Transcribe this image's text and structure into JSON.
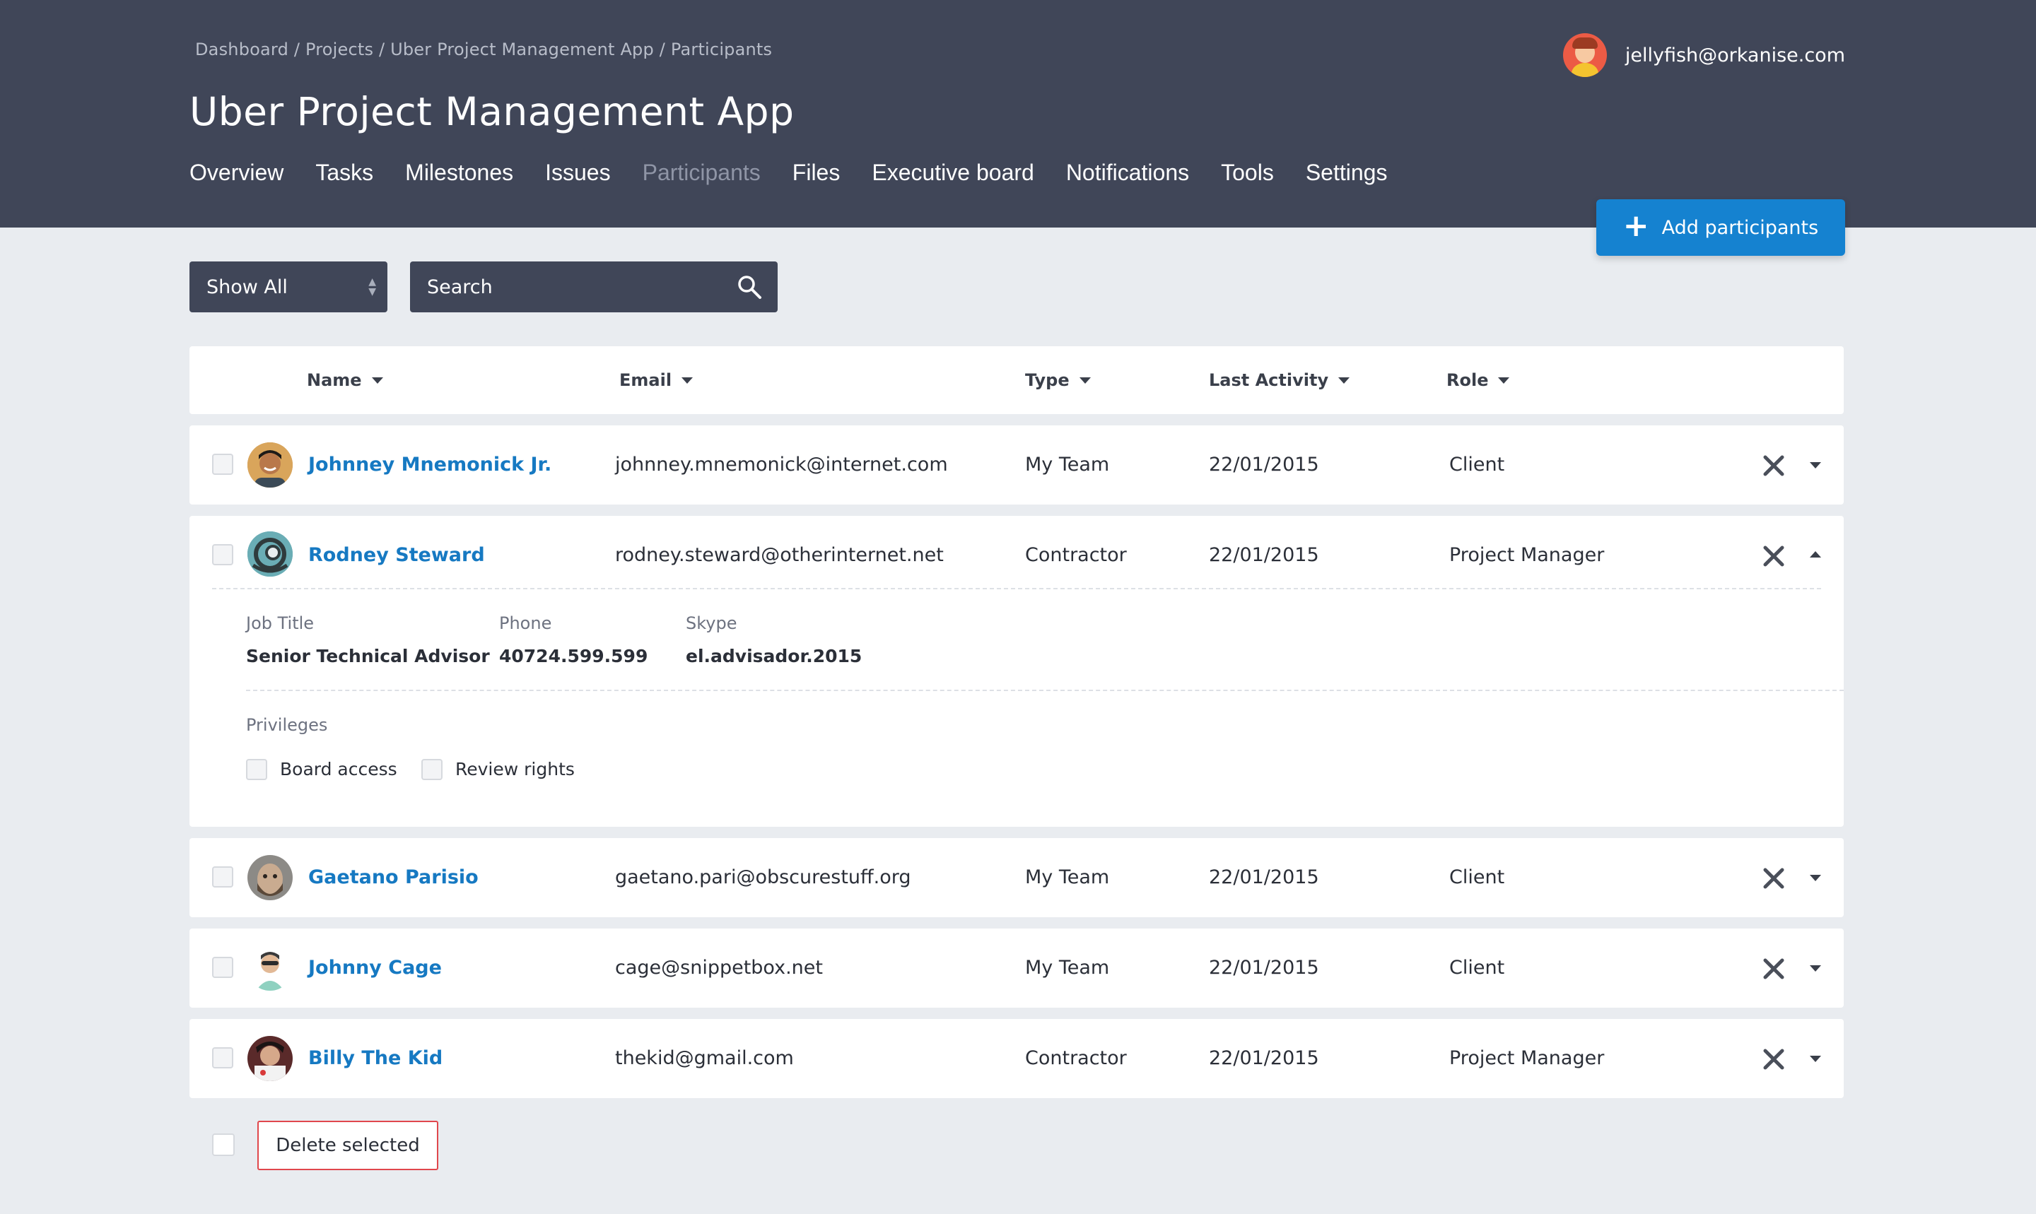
{
  "header": {
    "breadcrumb": "Dashboard / Projects / Uber Project Management App / Participants",
    "title": "Uber Project Management App",
    "user_email": "jellyfish@orkanise.com",
    "nav": [
      "Overview",
      "Tasks",
      "Milestones",
      "Issues",
      "Participants",
      "Files",
      "Executive board",
      "Notifications",
      "Tools",
      "Settings"
    ],
    "active_nav": "Participants"
  },
  "toolbar": {
    "add_label": "Add participants",
    "filter_value": "Show All",
    "search_placeholder": "Search"
  },
  "table": {
    "columns": [
      "Name",
      "Email",
      "Type",
      "Last Activity",
      "Role"
    ],
    "rows": [
      {
        "name": "Johnney Mnemonick Jr.",
        "email": "johnney.mnemonick@internet.com",
        "type": "My Team",
        "last_activity": "22/01/2015",
        "role": "Client",
        "expanded": false
      },
      {
        "name": "Rodney Steward",
        "email": "rodney.steward@otherinternet.net",
        "type": "Contractor",
        "last_activity": "22/01/2015",
        "role": "Project Manager",
        "expanded": true
      },
      {
        "name": "Gaetano Parisio",
        "email": "gaetano.pari@obscurestuff.org",
        "type": "My Team",
        "last_activity": "22/01/2015",
        "role": "Client",
        "expanded": false
      },
      {
        "name": "Johnny Cage",
        "email": "cage@snippetbox.net",
        "type": "My Team",
        "last_activity": "22/01/2015",
        "role": "Client",
        "expanded": false
      },
      {
        "name": "Billy The Kid",
        "email": "thekid@gmail.com",
        "type": "Contractor",
        "last_activity": "22/01/2015",
        "role": "Project Manager",
        "expanded": false
      }
    ]
  },
  "details": {
    "job_title_label": "Job Title",
    "job_title": "Senior Technical Advisor",
    "phone_label": "Phone",
    "phone": "40724.599.599",
    "skype_label": "Skype",
    "skype": "el.advisador.2015",
    "privileges_label": "Privileges",
    "privileges": [
      "Board access",
      "Review rights"
    ]
  },
  "footer": {
    "delete_label": "Delete selected"
  },
  "colors": {
    "header_bg": "#404658",
    "accent": "#1582d0",
    "link": "#1679c2",
    "danger": "#e0474c",
    "page_bg": "#e9ecf0"
  }
}
